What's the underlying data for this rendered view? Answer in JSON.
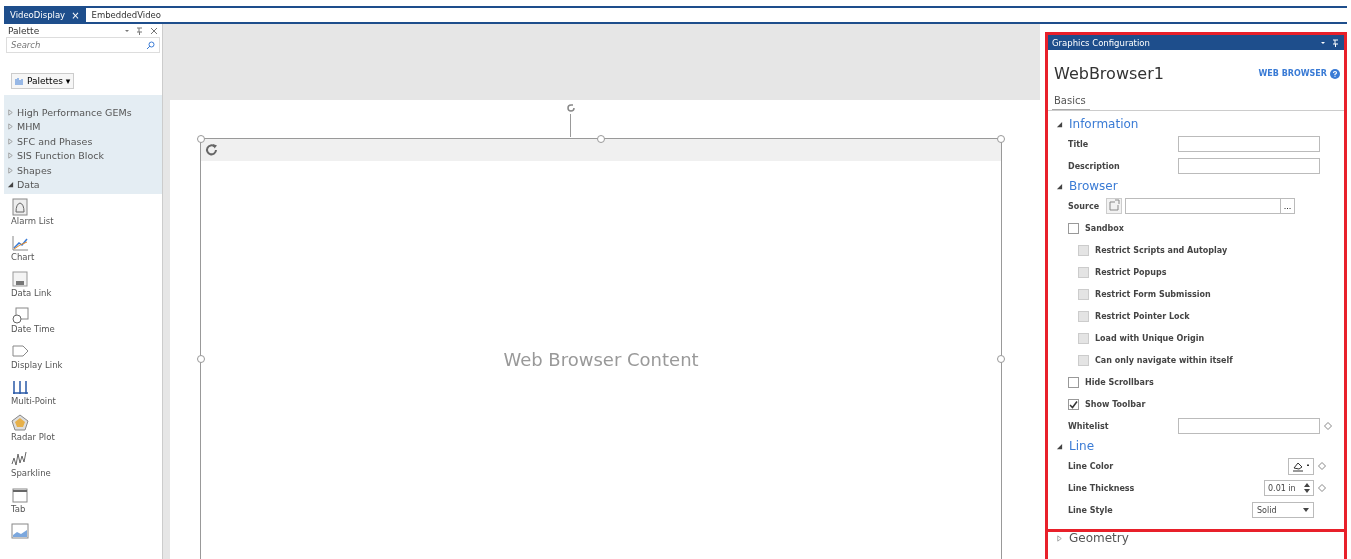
{
  "doc_tabs": [
    {
      "label": "VideoDisplay",
      "selected": true,
      "close": "×"
    },
    {
      "label": "EmbeddedVideo",
      "selected": false
    }
  ],
  "palette": {
    "title": "Palette",
    "search": {
      "placeholder": "Search"
    },
    "palettes_button": "Palettes ▾",
    "tree": [
      {
        "label": "High Performance GEMs",
        "expanded": false
      },
      {
        "label": "MHM",
        "expanded": false
      },
      {
        "label": "SFC and Phases",
        "expanded": false
      },
      {
        "label": "SIS Function Block",
        "expanded": false
      },
      {
        "label": "Shapes",
        "expanded": false
      },
      {
        "label": "Data",
        "expanded": true
      }
    ],
    "items": [
      {
        "label": "Alarm List",
        "kind": "alarm"
      },
      {
        "label": "Chart",
        "kind": "chart"
      },
      {
        "label": "Data Link",
        "kind": "datalink"
      },
      {
        "label": "Date Time",
        "kind": "datetime"
      },
      {
        "label": "Display Link",
        "kind": "displaylink"
      },
      {
        "label": "Multi-Point",
        "kind": "multipoint"
      },
      {
        "label": "Radar Plot",
        "kind": "radar"
      },
      {
        "label": "Sparkline",
        "kind": "sparkline"
      },
      {
        "label": "Tab",
        "kind": "tab"
      },
      {
        "kind": "trend"
      }
    ]
  },
  "canvas": {
    "content_label": "Web Browser Content"
  },
  "config": {
    "header": "Graphics Configuration",
    "object_name": "WebBrowser1",
    "object_type": "WEB BROWSER",
    "tab": "Basics",
    "sections": [
      {
        "title": "Information",
        "expanded": true,
        "rows": [
          {
            "kind": "text",
            "label": "Title"
          },
          {
            "kind": "text",
            "label": "Description"
          }
        ]
      },
      {
        "title": "Browser",
        "expanded": true,
        "rows": [
          {
            "kind": "source",
            "label": "Source",
            "button": "..."
          },
          {
            "kind": "check",
            "label": "Sandbox",
            "checked": false,
            "disabled": false,
            "children": [
              {
                "kind": "check",
                "label": "Restrict Scripts and Autoplay",
                "checked": false,
                "disabled": true
              },
              {
                "kind": "check",
                "label": "Restrict Popups",
                "checked": false,
                "disabled": true
              },
              {
                "kind": "check",
                "label": "Restrict Form Submission",
                "checked": false,
                "disabled": true
              },
              {
                "kind": "check",
                "label": "Restrict Pointer Lock",
                "checked": false,
                "disabled": true
              },
              {
                "kind": "check",
                "label": "Load with Unique Origin",
                "checked": false,
                "disabled": true
              },
              {
                "kind": "check",
                "label": "Can only navigate within itself",
                "checked": false,
                "disabled": true
              }
            ]
          },
          {
            "kind": "check",
            "label": "Hide Scrollbars",
            "checked": false,
            "disabled": false
          },
          {
            "kind": "check",
            "label": "Show Toolbar",
            "checked": true,
            "disabled": false
          },
          {
            "kind": "wide",
            "label": "Whitelist"
          }
        ]
      },
      {
        "title": "Line",
        "expanded": true,
        "rows": [
          {
            "kind": "color",
            "label": "Line Color"
          },
          {
            "kind": "spin",
            "label": "Line Thickness",
            "value": "0.01 in"
          },
          {
            "kind": "select",
            "label": "Line Style",
            "value": "Solid"
          }
        ]
      }
    ],
    "collapsed": [
      {
        "title": "Geometry",
        "expanded": false
      }
    ]
  }
}
